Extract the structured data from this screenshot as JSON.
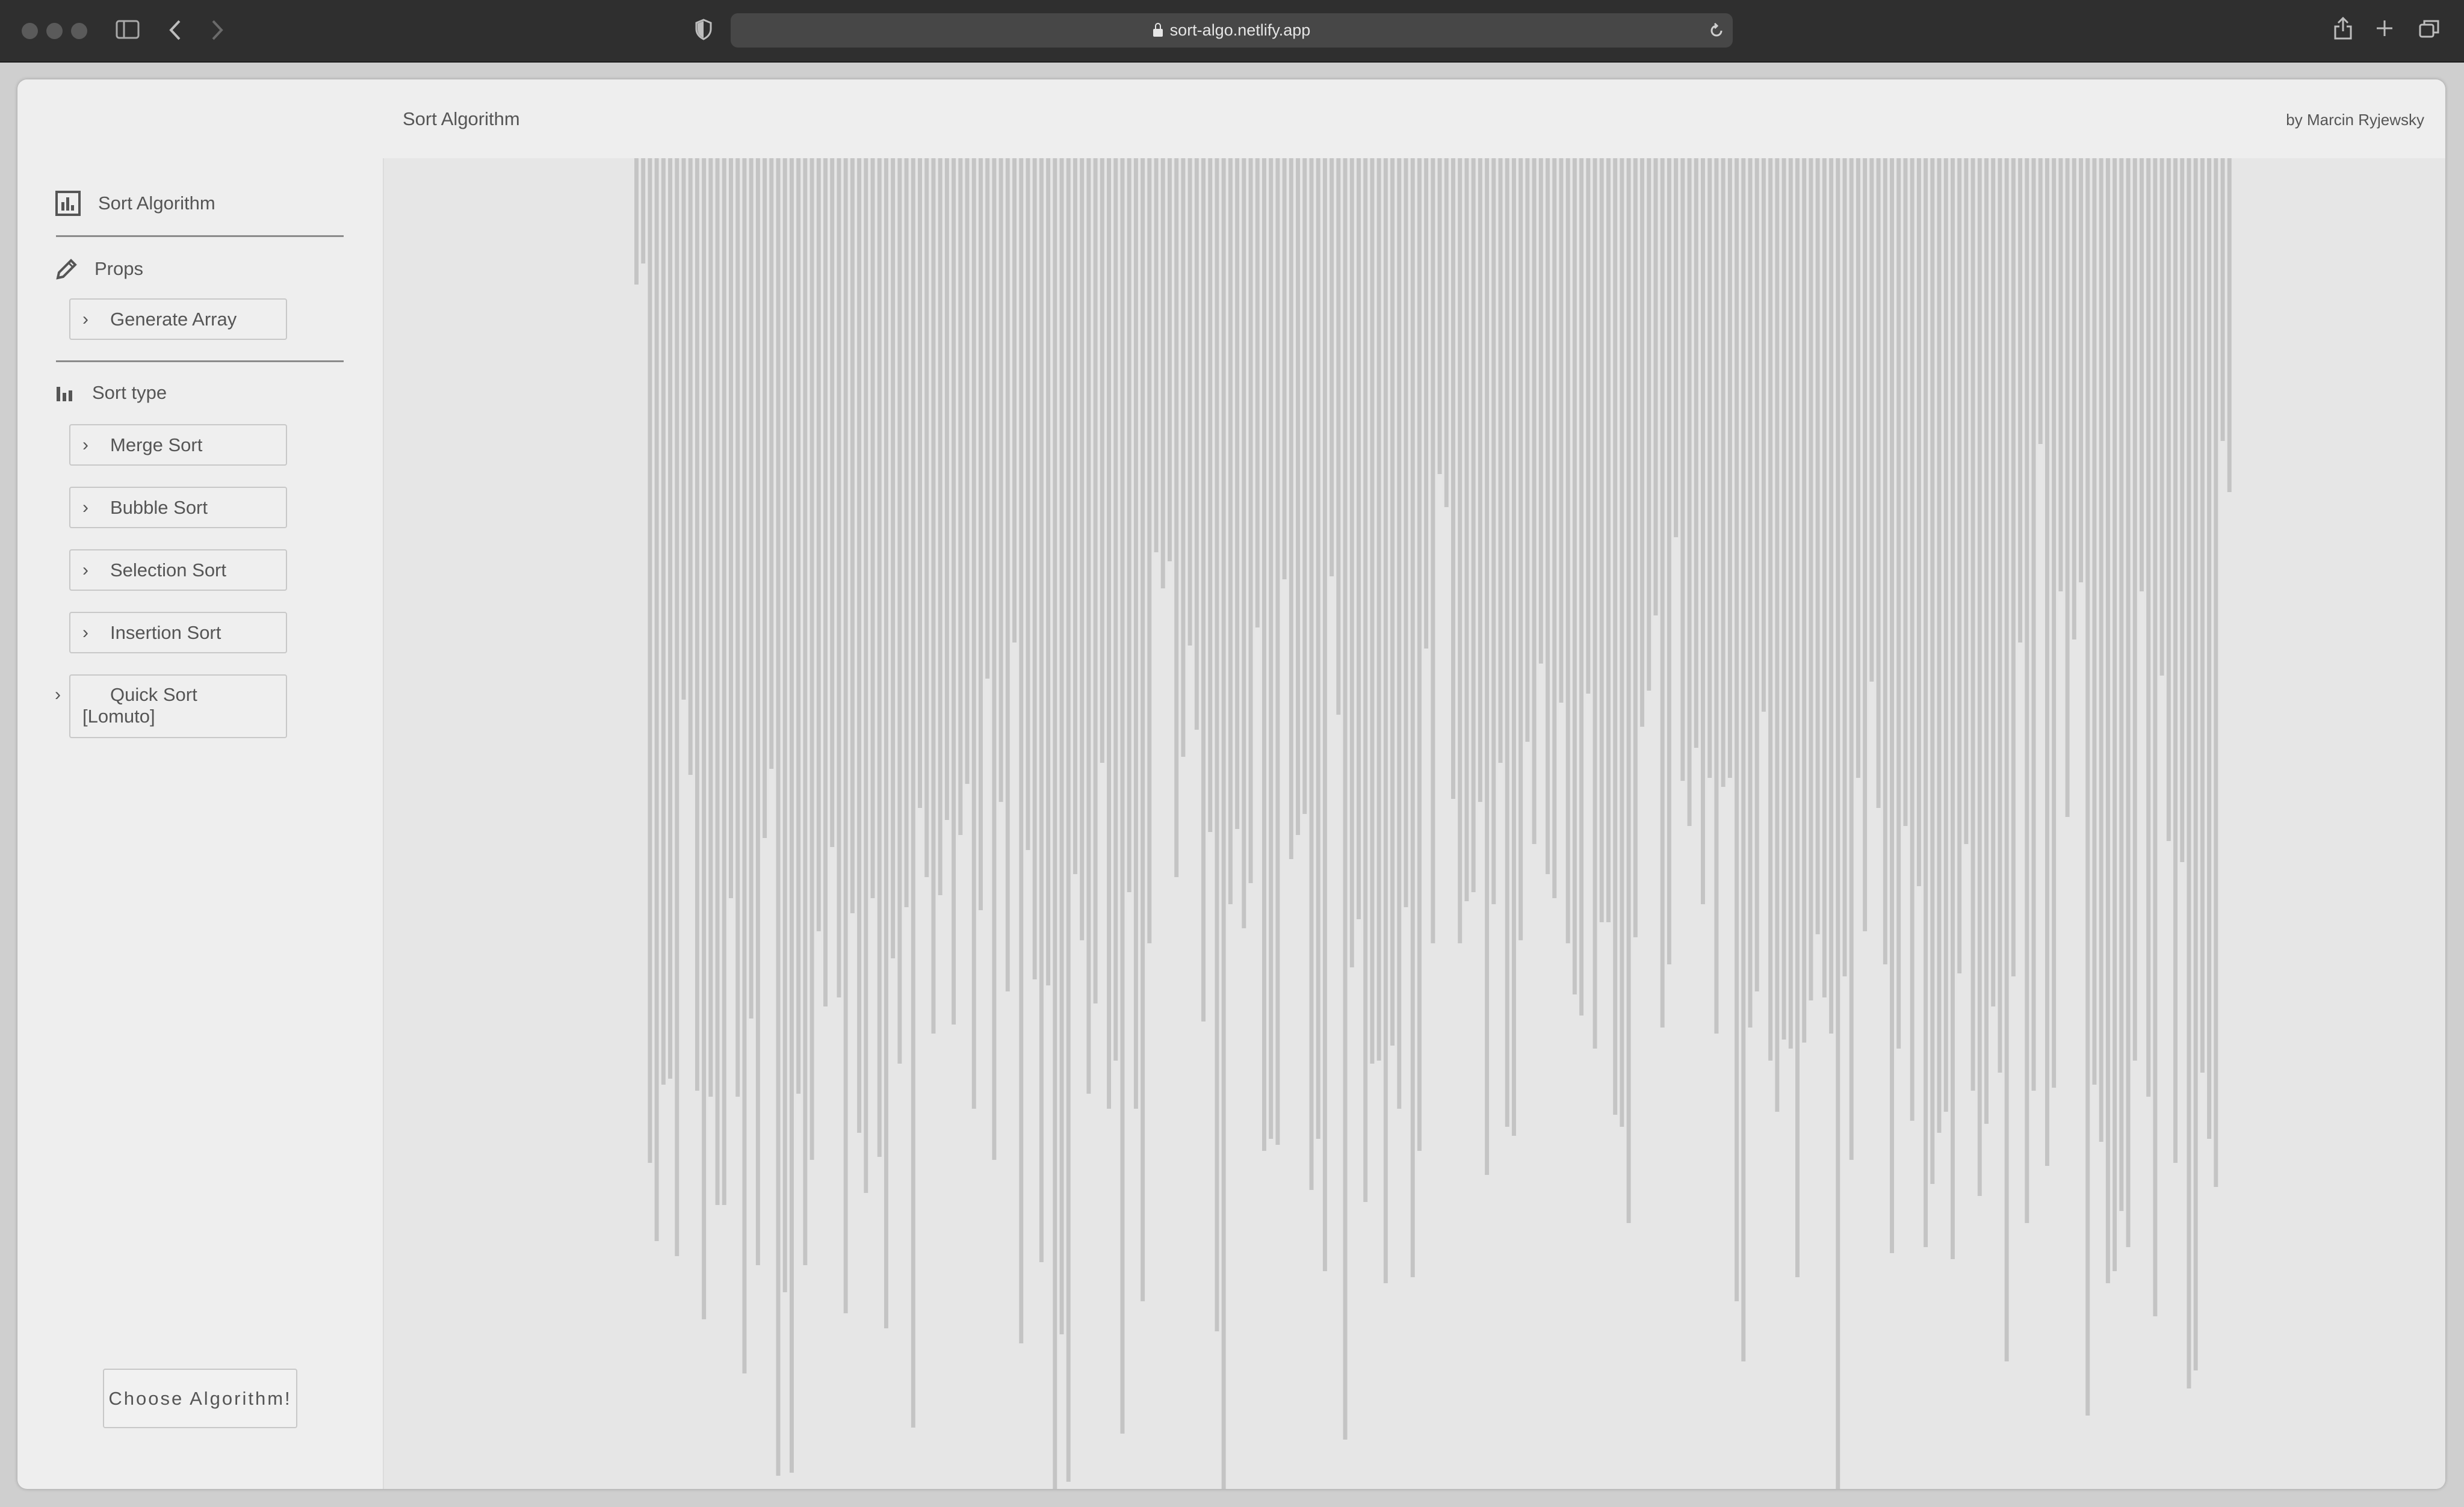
{
  "browser": {
    "url": "sort-algo.netlify.app"
  },
  "header": {
    "title": "Sort Algorithm",
    "byline": "by Marcin Ryjewsky"
  },
  "sidebar": {
    "app_label": "Sort Algorithm",
    "props_label": "Props",
    "generate_label": "Generate Array",
    "sort_type_label": "Sort type",
    "sorts": [
      "Merge Sort",
      "Bubble Sort",
      "Selection Sort",
      "Insertion Sort",
      "Quick Sort [Lomuto]"
    ],
    "choose_label": "Choose Algorithm!"
  },
  "chart_data": {
    "type": "bar",
    "orientation": "hanging-from-top",
    "bar_color": "#c4c4c4",
    "values": [
      210,
      175,
      1670,
      1800,
      1540,
      1530,
      1825,
      900,
      1025,
      1550,
      1930,
      1560,
      1740,
      1740,
      1230,
      1560,
      2020,
      1430,
      1840,
      1130,
      1015,
      2190,
      1885,
      2185,
      1555,
      1840,
      1665,
      1285,
      1410,
      1145,
      1395,
      1920,
      1255,
      1620,
      1720,
      1230,
      1660,
      1945,
      1330,
      1505,
      1245,
      2110,
      1080,
      1195,
      1455,
      1225,
      1100,
      1440,
      1125,
      1040,
      1580,
      1250,
      865,
      1665,
      1070,
      1385,
      805,
      1970,
      1150,
      1365,
      1835,
      1375,
      2250,
      1955,
      2200,
      1190,
      1300,
      1555,
      1405,
      1005,
      1580,
      1500,
      2120,
      1220,
      1580,
      1900,
      1305,
      655,
      715,
      670,
      1195,
      995,
      810,
      950,
      1435,
      1120,
      1950,
      2225,
      1240,
      1115,
      1280,
      1205,
      780,
      1650,
      1630,
      1640,
      700,
      1165,
      1125,
      1090,
      1715,
      1630,
      1850,
      695,
      925,
      2130,
      1345,
      1265,
      1735,
      1505,
      1500,
      1870,
      1475,
      1580,
      1245,
      1860,
      1650,
      815,
      1305,
      525,
      580,
      1065,
      1305,
      1235,
      1220,
      1070,
      1690,
      1240,
      1005,
      1610,
      1625,
      1300,
      970,
      1140,
      840,
      1190,
      1230,
      905,
      1305,
      1390,
      1425,
      890,
      1480,
      1270,
      1270,
      1590,
      1610,
      1770,
      1295,
      945,
      885,
      760,
      1445,
      1340,
      630,
      1035,
      1110,
      980,
      1240,
      1030,
      1455,
      1045,
      1030,
      1900,
      2000,
      1445,
      1385,
      920,
      1500,
      1585,
      1465,
      1480,
      1860,
      1470,
      1400,
      1290,
      1395,
      1455,
      2250,
      1360,
      1665,
      1030,
      1285,
      870,
      1080,
      1340,
      1820,
      1480,
      1110,
      1600,
      1210,
      1810,
      1705,
      1620,
      1585,
      1830,
      1355,
      1140,
      1550,
      1725,
      1605,
      1410,
      1520,
      2000,
      1360,
      805,
      1770,
      1550,
      475,
      1675,
      1545,
      720,
      1095,
      800,
      705,
      2090,
      1540,
      1635,
      1870,
      1850,
      1750,
      1810,
      1500,
      720,
      1560,
      1925,
      860,
      1135,
      1670,
      1170,
      2045,
      2015,
      1520,
      1630,
      1710,
      470,
      555
    ]
  }
}
